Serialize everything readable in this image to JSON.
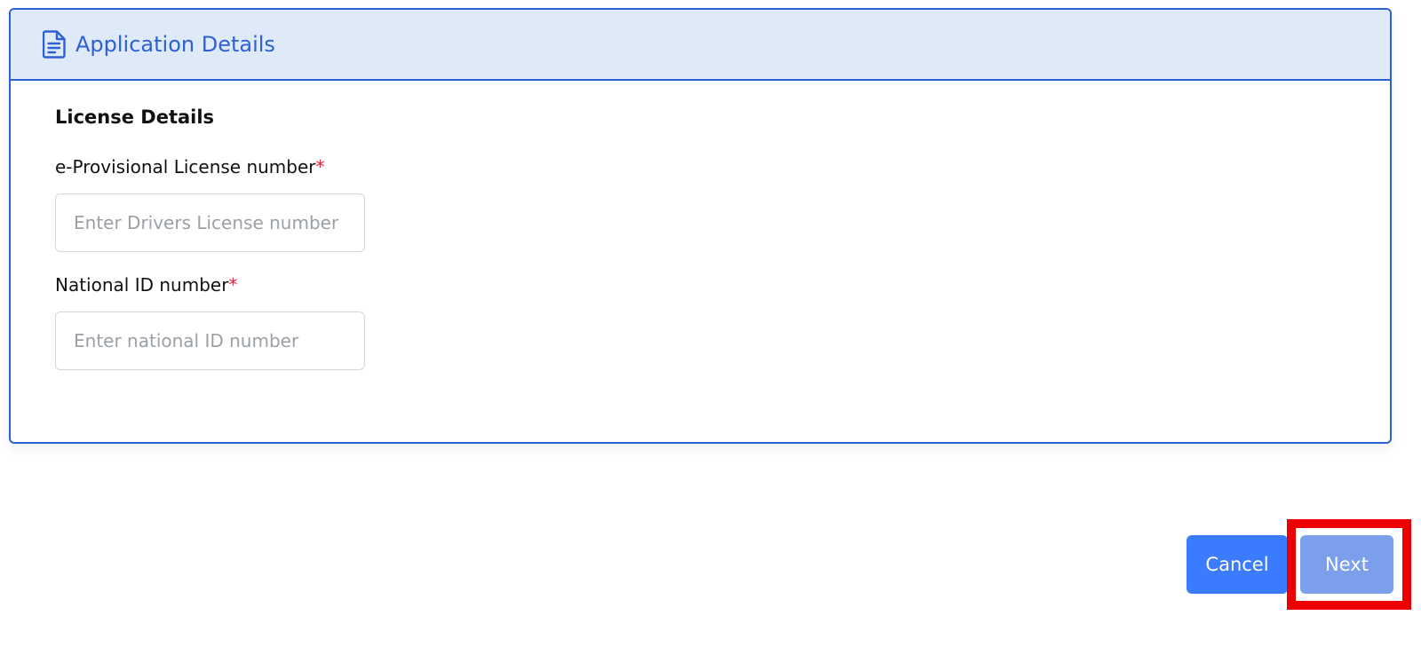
{
  "header": {
    "title": "Application Details",
    "icon": "document-icon",
    "accent_color": "#2d5fd6",
    "background_color": "#dfeaf8"
  },
  "section": {
    "title": "License Details"
  },
  "fields": {
    "provisional_license": {
      "label": "e-Provisional License number",
      "required_marker": "*",
      "value": "",
      "placeholder": "Enter Drivers License number"
    },
    "national_id": {
      "label": "National ID number",
      "required_marker": "*",
      "value": "",
      "placeholder": "Enter national ID number"
    }
  },
  "actions": {
    "cancel_label": "Cancel",
    "next_label": "Next",
    "cancel_color": "#3b7bff",
    "next_color": "#7b9fea",
    "highlight_color": "#ee0000"
  }
}
